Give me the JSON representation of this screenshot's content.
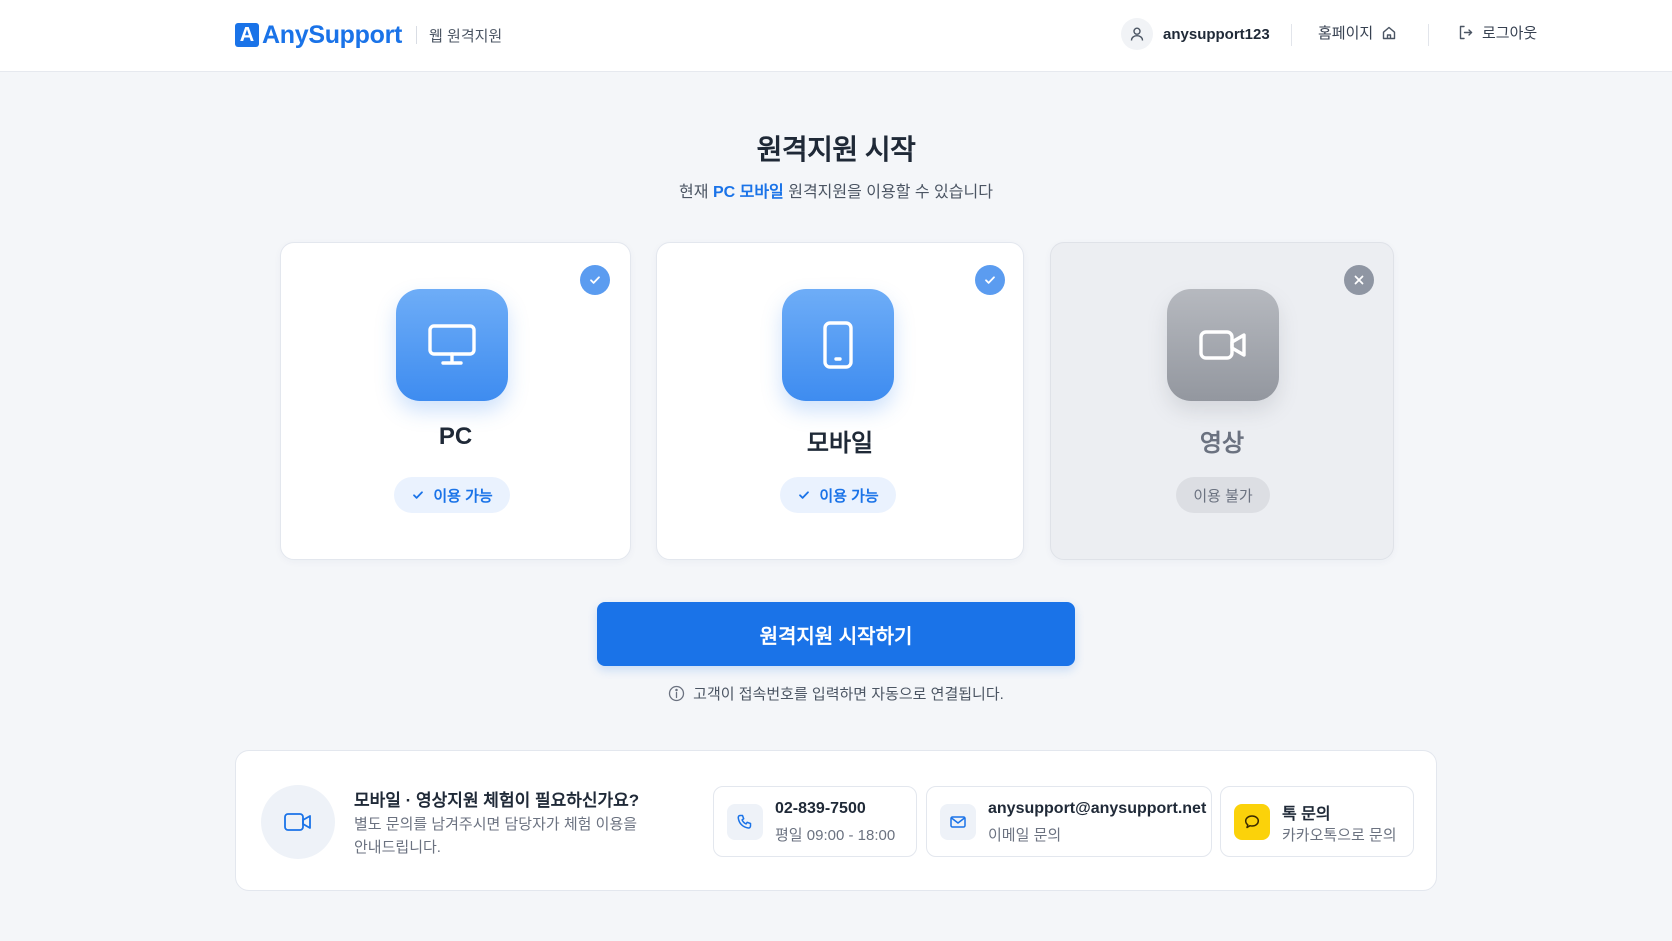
{
  "header": {
    "logo_mark": "A",
    "logo_text": "AnySupport",
    "section": "웹 원격지원",
    "user_name": "anysupport123",
    "homepage_label": "홈페이지",
    "logout_label": "로그아웃"
  },
  "main": {
    "title": "원격지원 시작",
    "subtitle_prefix": "현재 ",
    "subtitle_highlight": "PC 모바일",
    "subtitle_suffix": " 원격지원을 이용할 수 있습니다"
  },
  "cards": [
    {
      "name": "PC",
      "status": "이용 가능",
      "available": true,
      "icon": "monitor-icon"
    },
    {
      "name": "모바일",
      "status": "이용 가능",
      "available": true,
      "icon": "smartphone-icon"
    },
    {
      "name": "영상",
      "status": "이용 불가",
      "available": false,
      "icon": "video-camera-icon"
    }
  ],
  "start_button": {
    "label": "원격지원 시작하기"
  },
  "hint": {
    "text": "고객이 접속번호를 입력하면 자동으로 연결됩니다."
  },
  "panel": {
    "title": "모바일 · 영상지원 체험이 필요하신가요?",
    "description": "별도 문의를 남겨주시면 담당자가 체험 이용을 안내드립니다.",
    "contacts": [
      {
        "main": "02-839-7500",
        "sub": "평일 09:00 - 18:00",
        "icon": "phone-icon"
      },
      {
        "main": "anysupport@anysupport.net",
        "sub": "이메일 문의",
        "icon": "mail-icon"
      },
      {
        "main": "톡 문의",
        "sub": "카카오톡으로 문의",
        "icon": "chat-bubble-icon"
      }
    ]
  },
  "colors": {
    "brand": "#1a73e8",
    "background": "#f4f6f9",
    "available_badge_bg": "#eaf2fe",
    "disabled_card_bg": "#eceef2",
    "kakao": "#fbd20a"
  }
}
